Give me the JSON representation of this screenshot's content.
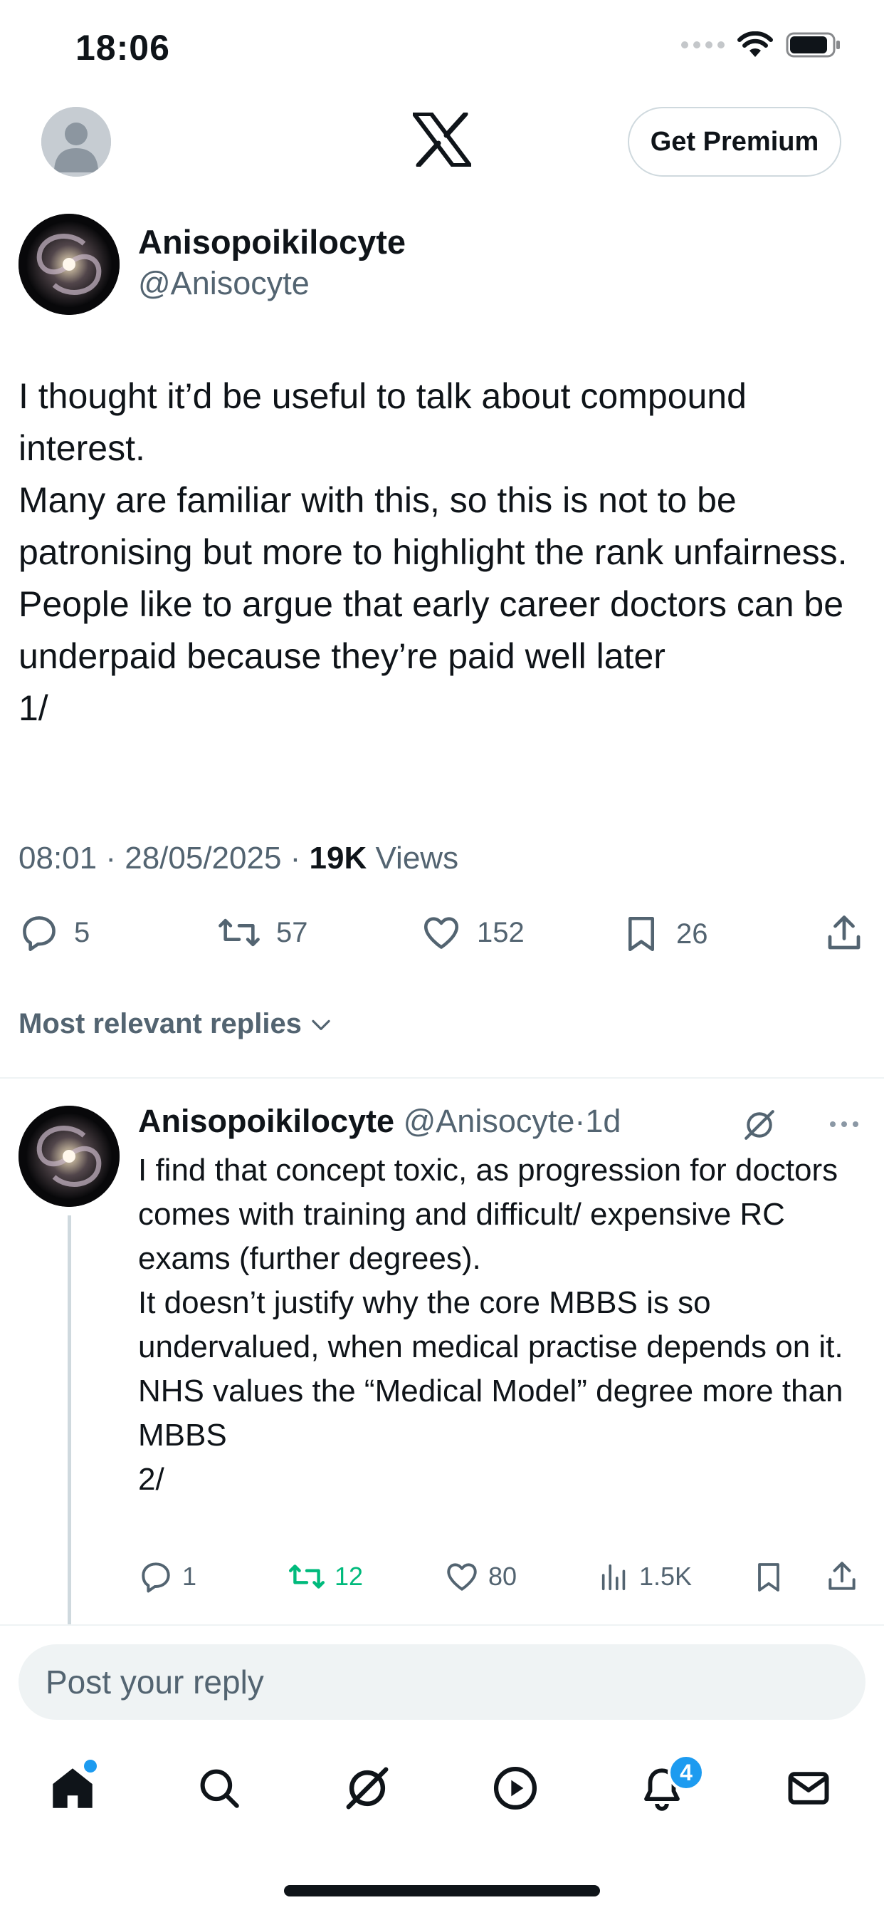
{
  "status_bar": {
    "time": "18:06"
  },
  "top_nav": {
    "premium_label": "Get Premium"
  },
  "tweet": {
    "author_name": "Anisopoikilocyte",
    "author_handle": "@Anisocyte",
    "text": "I thought it’d be useful to talk about compound interest.\nMany are familiar with this, so this is not to be patronising but more to highlight the rank unfairness.\nPeople like to argue that early career doctors can be underpaid because they’re paid well later\n1/",
    "time": "08:01",
    "date": "28/05/2025",
    "views_count": "19K",
    "views_label": "Views",
    "replies": "5",
    "reposts": "57",
    "likes": "152",
    "bookmarks": "26"
  },
  "replies_sort_label": "Most relevant replies",
  "reply": {
    "author_name": "Anisopoikilocyte",
    "author_handle": "@Anisocyte",
    "age": "1d",
    "text": "I find that concept toxic, as progression for doctors comes with training and difficult/ expensive RC exams (further degrees).\nIt doesn’t justify why the core MBBS is so undervalued, when medical practise depends on it.\nNHS values the “Medical Model” degree more than MBBS\n2/",
    "replies": "1",
    "reposts": "12",
    "likes": "80",
    "views": "1.5K"
  },
  "composer": {
    "placeholder": "Post your reply"
  },
  "tab_bar": {
    "items": [
      "home-icon",
      "search-icon",
      "grok-icon",
      "video-icon",
      "notifications-icon",
      "messages-icon"
    ],
    "notification_count": "4"
  },
  "colors": {
    "text_primary": "#0f1419",
    "text_secondary": "#536471",
    "accent_blue": "#1d9bf0",
    "repost_active_green": "#00ba7c"
  }
}
